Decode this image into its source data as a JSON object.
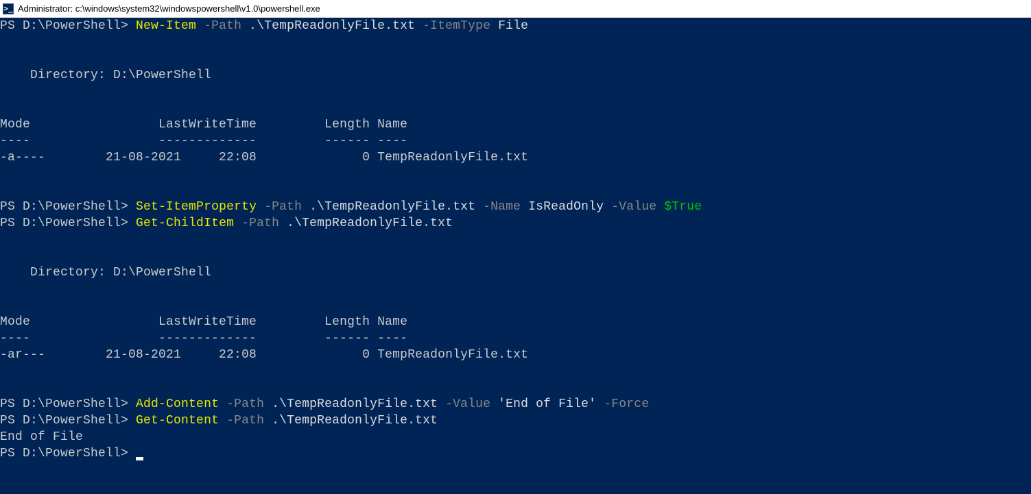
{
  "window": {
    "title": "Administrator: c:\\windows\\system32\\windowspowershell\\v1.0\\powershell.exe",
    "icon_glyph": ">_"
  },
  "cmd1": {
    "prompt": "PS D:\\PowerShell> ",
    "cmdlet": "New-Item",
    "param_path": " -Path",
    "arg_path": " .\\TempReadonlyFile.txt",
    "param_itemtype": " -ItemType",
    "arg_itemtype": " File"
  },
  "out1": {
    "blank": "",
    "dirline": "    Directory: D:\\PowerShell",
    "header": "Mode                 LastWriteTime         Length Name",
    "divider": "----                 -------------         ------ ----",
    "row": "-a----        21-08-2021     22:08              0 TempReadonlyFile.txt"
  },
  "cmd2": {
    "prompt": "PS D:\\PowerShell> ",
    "cmdlet": "Set-ItemProperty",
    "param_path": " -Path",
    "arg_path": " .\\TempReadonlyFile.txt",
    "param_name": " -Name",
    "arg_name": " IsReadOnly",
    "param_value": " -Value",
    "arg_value": " $True"
  },
  "cmd3": {
    "prompt": "PS D:\\PowerShell> ",
    "cmdlet": "Get-ChildItem",
    "param_path": " -Path",
    "arg_path": " .\\TempReadonlyFile.txt"
  },
  "out2": {
    "dirline": "    Directory: D:\\PowerShell",
    "header": "Mode                 LastWriteTime         Length Name",
    "divider": "----                 -------------         ------ ----",
    "row": "-ar---        21-08-2021     22:08              0 TempReadonlyFile.txt"
  },
  "cmd4": {
    "prompt": "PS D:\\PowerShell> ",
    "cmdlet": "Add-Content",
    "param_path": " -Path",
    "arg_path": " .\\TempReadonlyFile.txt",
    "param_value": " -Value",
    "arg_value": " 'End of File'",
    "param_force": " -Force"
  },
  "cmd5": {
    "prompt": "PS D:\\PowerShell> ",
    "cmdlet": "Get-Content",
    "param_path": " -Path",
    "arg_path": " .\\TempReadonlyFile.txt"
  },
  "out3": {
    "line": "End of File"
  },
  "cmd6": {
    "prompt": "PS D:\\PowerShell> "
  }
}
